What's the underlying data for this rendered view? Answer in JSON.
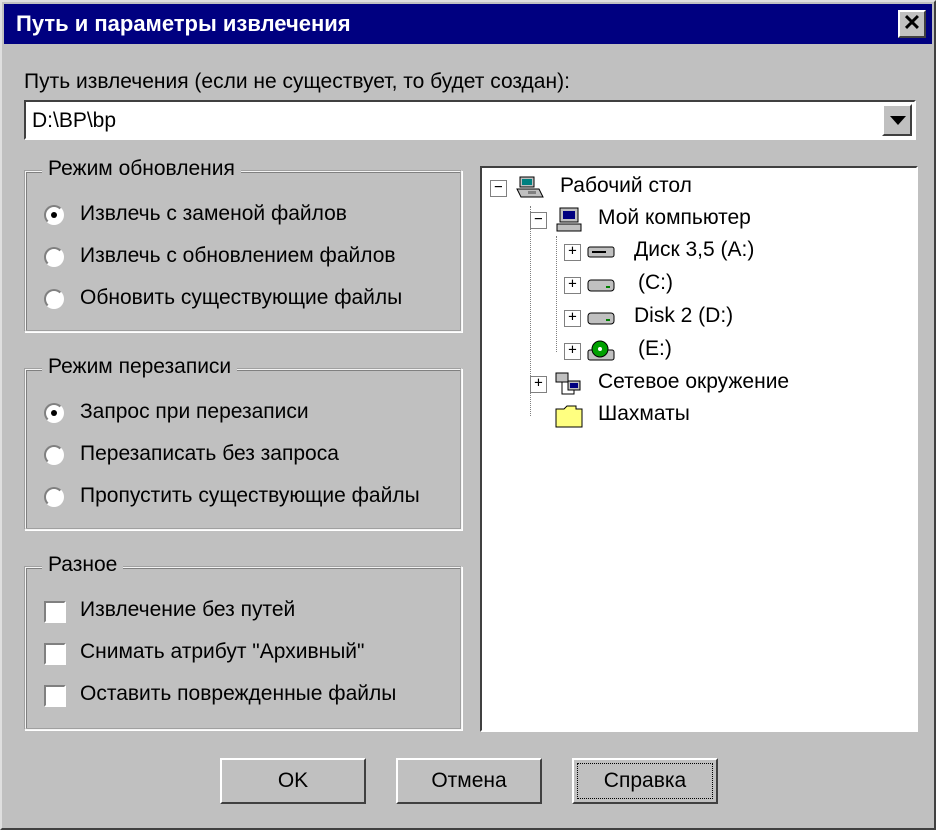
{
  "window": {
    "title": "Путь и параметры извлечения",
    "close_glyph": "✕"
  },
  "path": {
    "label": "Путь извлечения (если не существует, то будет создан):",
    "value": "D:\\BP\\bp"
  },
  "update_mode": {
    "legend": "Режим обновления",
    "options": [
      {
        "label": "Извлечь с заменой файлов",
        "selected": true
      },
      {
        "label": "Извлечь с обновлением файлов",
        "selected": false
      },
      {
        "label": "Обновить существующие файлы",
        "selected": false
      }
    ]
  },
  "overwrite_mode": {
    "legend": "Режим перезаписи",
    "options": [
      {
        "label": "Запрос при перезаписи",
        "selected": true
      },
      {
        "label": "Перезаписать без запроса",
        "selected": false
      },
      {
        "label": "Пропустить существующие файлы",
        "selected": false
      }
    ]
  },
  "misc": {
    "legend": "Разное",
    "options": [
      {
        "label": "Извлечение без путей",
        "checked": false
      },
      {
        "label": "Снимать атрибут \"Архивный\"",
        "checked": false
      },
      {
        "label": "Оставить поврежденные файлы",
        "checked": false
      }
    ]
  },
  "tree": {
    "nodes": [
      {
        "label": "Рабочий стол",
        "icon": "desktop-icon",
        "toggle": "−"
      },
      {
        "label": "Мой компьютер",
        "icon": "computer-icon",
        "toggle": "−"
      },
      {
        "label": "Диск 3,5 (A:)",
        "icon": "floppy-drive-icon",
        "toggle": "+"
      },
      {
        "label": "(C:)",
        "icon": "hard-drive-icon",
        "toggle": "+"
      },
      {
        "label": "Disk 2 (D:)",
        "icon": "hard-drive-icon",
        "toggle": "+"
      },
      {
        "label": "(E:)",
        "icon": "cd-drive-icon",
        "toggle": "+"
      },
      {
        "label": "Сетевое окружение",
        "icon": "network-icon",
        "toggle": "+"
      },
      {
        "label": "Шахматы",
        "icon": "folder-icon",
        "toggle": ""
      }
    ]
  },
  "buttons": {
    "ok": "OK",
    "cancel": "Отмена",
    "help": "Справка"
  },
  "colors": {
    "titlebar": "#000080",
    "face": "#c0c0c0"
  }
}
